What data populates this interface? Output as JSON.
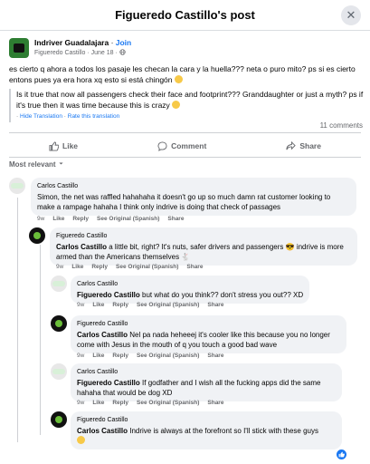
{
  "header": {
    "title": "Figueredo Castillo's post",
    "close_label": "✕"
  },
  "post": {
    "group": "Indriver Guadalajara",
    "separator": " · ",
    "join": "Join",
    "author": "Figueredo Castillo",
    "date": " · June 18 · ",
    "text": "es cierto q ahora a todos los pasaje les checan la cara y la huella??? neta o puro mito? ps si es cierto entons pues ya era hora xq esto si está chingón",
    "translation": "Is it true that now all passengers check their face and footprint??? Granddaughter or just a myth? ps if it's true then it was time because this is crazy",
    "hide_translation": "Hide Translation",
    "rate_translation": "Rate this translation",
    "comments_count": "11 comments"
  },
  "actions": {
    "like": "Like",
    "comment": "Comment",
    "share": "Share"
  },
  "sort": {
    "label": "Most relevant"
  },
  "comments": [
    {
      "author": "Carlos Castillo",
      "mention": "",
      "text": "Simon, the net was raffled hahahaha it doesn't go up so much damn rat customer looking to make a rampage hahaha I think only indrive is doing that check of passages",
      "time": "9w",
      "like": "Like",
      "reply": "Reply",
      "see_original": "See Original (Spanish)",
      "share": "Share"
    },
    {
      "author": "Figueredo Castillo",
      "mention": "Carlos Castillo",
      "text": " a little bit, right? It's nuts, safer drivers and passengers 😎 indrive is more armed than the Americans themselves 🐇",
      "time": "9w",
      "like": "Like",
      "reply": "Reply",
      "see_original": "See Original (Spanish)",
      "share": "Share"
    },
    {
      "author": "Carlos Castillo",
      "mention": "Figueredo Castillo",
      "text": " but what do you think?? don't stress you out?? XD",
      "time": "9w",
      "like": "Like",
      "reply": "Reply",
      "see_original": "See Original (Spanish)",
      "share": "Share"
    },
    {
      "author": "Figueredo Castillo",
      "mention": "Carlos Castillo",
      "text": " Nel pa nada heheeej it's cooler like this because you no longer come with Jesus in the mouth of q you touch a good bad wave",
      "time": "9w",
      "like": "Like",
      "reply": "Reply",
      "see_original": "See Original (Spanish)",
      "share": "Share"
    },
    {
      "author": "Carlos Castillo",
      "mention": "Figueredo Castillo",
      "text": " If godfather and I wish all the fucking apps did the same hahaha that would be dog XD",
      "time": "9w",
      "like": "Like",
      "reply": "Reply",
      "see_original": "See Original (Spanish)",
      "share": "Share"
    },
    {
      "author": "Figueredo Castillo",
      "mention": "Carlos Castillo",
      "text": " Indrive is always at the forefront so I'll stick with these guys",
      "time": "",
      "like": "",
      "reply": "",
      "see_original": "",
      "share": ""
    }
  ]
}
